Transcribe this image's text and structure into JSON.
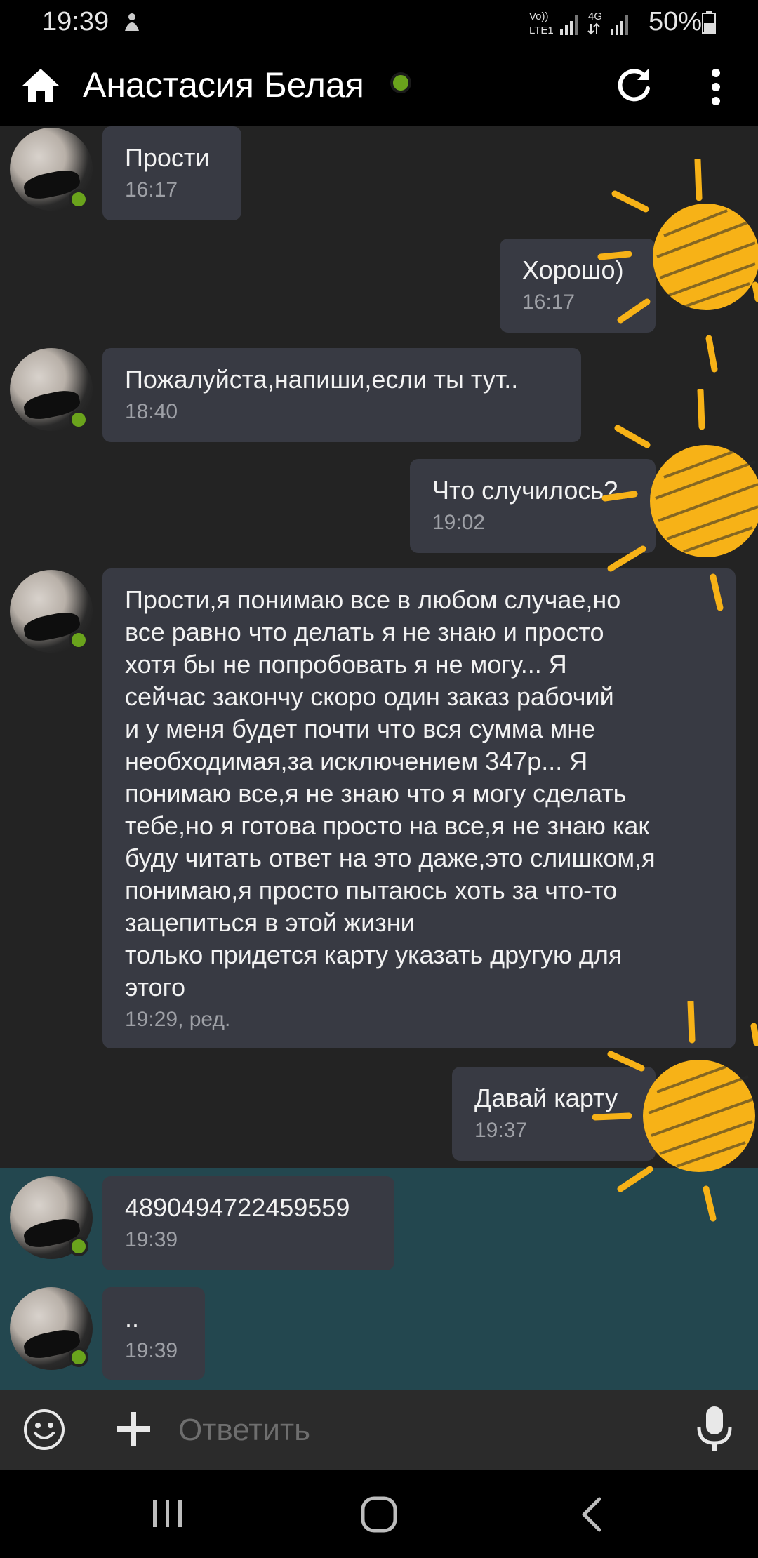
{
  "status_bar": {
    "time": "19:39",
    "network_top": "Vo)) LTE1",
    "network_type": "4G",
    "battery": "50%"
  },
  "header": {
    "title": "Анастасия Белая",
    "online_color": "#6aa31c"
  },
  "messages": [
    {
      "sender": "them",
      "text": "Прости",
      "time": "16:17"
    },
    {
      "sender": "me",
      "text": "Хорошо)",
      "time": "16:17"
    },
    {
      "sender": "them",
      "text": "Пожалуйста,напиши,если ты тут..",
      "time": "18:40"
    },
    {
      "sender": "me",
      "text": "Что случилось?",
      "time": "19:02"
    },
    {
      "sender": "them",
      "text": "Прости,я понимаю все в любом случае,но\nвсе равно что делать я не знаю и просто\nхотя бы не попробовать я не могу... Я\nсейчас закончу скоро один заказ рабочий\nи у меня будет почти что вся сумма мне\nнеобходимая,за исключением 347р... Я\nпонимаю все,я не знаю что я могу сделать\nтебе,но я готова просто на все,я не знаю как\nбуду читать ответ на это даже,это слишком,я\nпонимаю,я просто пытаюсь хоть за что-то\nзацепиться в этой жизни\nтолько придется карту указать другую для\nэтого",
      "time": "19:29, ред."
    },
    {
      "sender": "me",
      "text": "Давай карту",
      "time": "19:37"
    },
    {
      "sender": "them",
      "text": "4890494722459559",
      "time": "19:39"
    },
    {
      "sender": "them",
      "text": "..",
      "time": "19:39"
    }
  ],
  "composer": {
    "placeholder": "Ответить"
  },
  "icons": {
    "home": "home-icon",
    "refresh": "refresh-icon",
    "more": "more-vertical-icon",
    "emoji": "emoji-icon",
    "plus": "plus-icon",
    "mic": "microphone-icon"
  },
  "colors": {
    "background": "#232323",
    "bubble": "#383a43",
    "highlight": "#23474f",
    "sun": "#f7b217"
  }
}
